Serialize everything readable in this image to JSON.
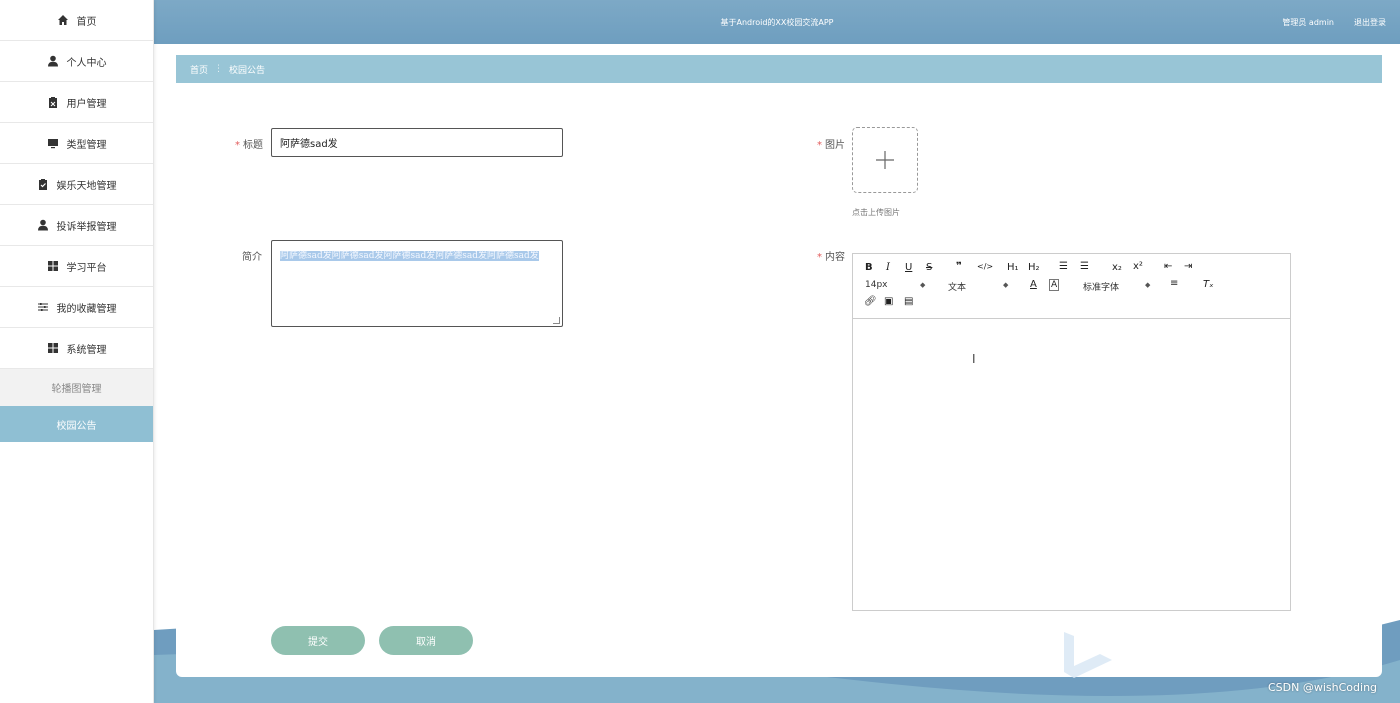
{
  "app": {
    "title": "基于Android的XX校园交流APP",
    "user": "管理员 admin",
    "logout": "退出登录"
  },
  "sidebar": {
    "items": [
      {
        "label": "首页",
        "icon": "home-icon"
      },
      {
        "label": "个人中心",
        "icon": "user-icon"
      },
      {
        "label": "用户管理",
        "icon": "clipboard-icon"
      },
      {
        "label": "类型管理",
        "icon": "monitor-icon"
      },
      {
        "label": "娱乐天地管理",
        "icon": "clipboard-check-icon"
      },
      {
        "label": "投诉举报管理",
        "icon": "user-icon"
      },
      {
        "label": "学习平台",
        "icon": "grid-icon"
      },
      {
        "label": "我的收藏管理",
        "icon": "sliders-icon"
      },
      {
        "label": "系统管理",
        "icon": "grid-icon"
      }
    ],
    "subitems": [
      {
        "label": "轮播图管理",
        "active": false
      },
      {
        "label": "校园公告",
        "active": true
      }
    ]
  },
  "breadcrumb": {
    "home": "首页",
    "separator": "⋮",
    "current": "校园公告"
  },
  "form": {
    "title_label": "标题",
    "title_value": "阿萨德sad发",
    "intro_label": "简介",
    "intro_value": "阿萨德sad发阿萨德sad发阿萨德sad发阿萨德sad发阿萨德sad发",
    "image_label": "图片",
    "upload_tip": "点击上传图片",
    "content_label": "内容",
    "submit": "提交",
    "cancel": "取消"
  },
  "editor": {
    "font_size": "14px",
    "format": "文本",
    "font_family": "标准字体"
  },
  "colors": {
    "header": "#6e9ebf",
    "breadcrumb": "#98c5d6",
    "active_sidebar": "#8fbfd3",
    "button": "#8fc0b0",
    "required_star": "#e25b5b"
  },
  "watermark": "CSDN @wishCoding"
}
